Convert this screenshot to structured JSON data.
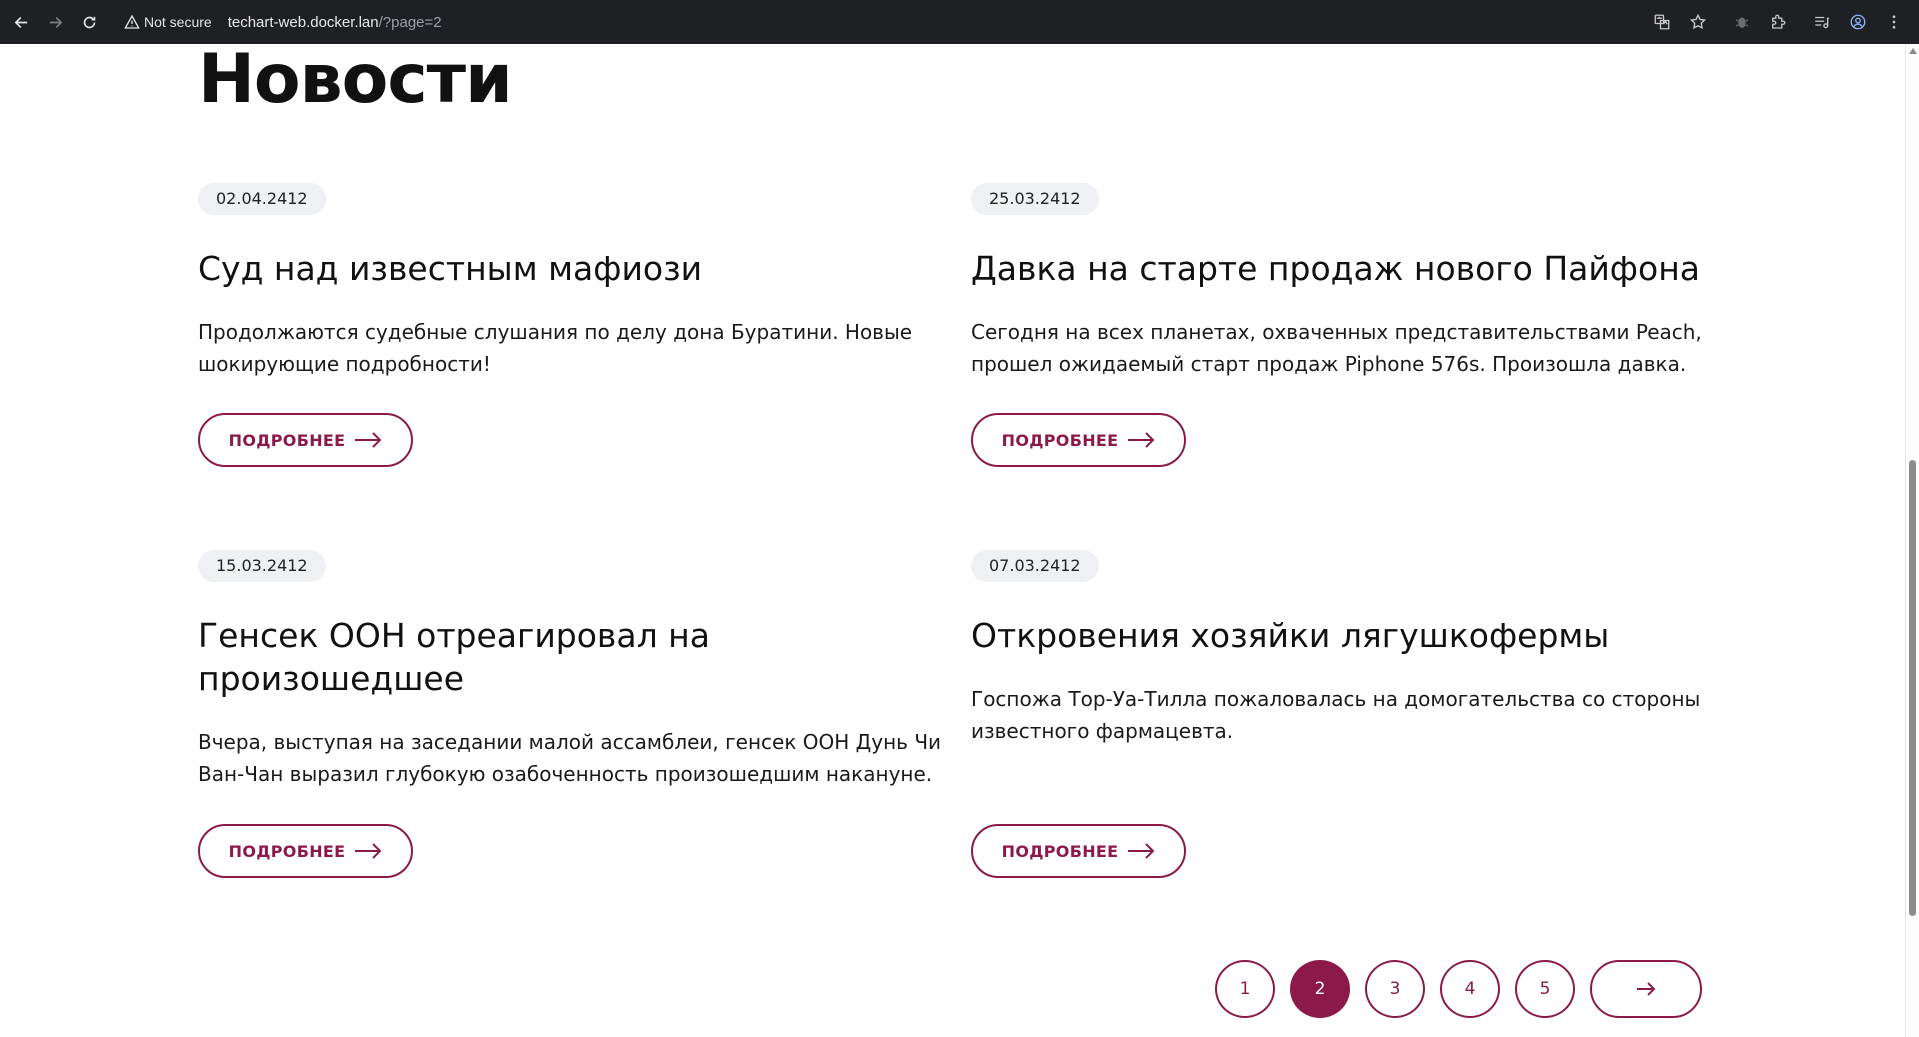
{
  "browser": {
    "security_label": "Not secure",
    "url_host": "techart-web.docker.lan",
    "url_path": "/?page=2"
  },
  "page": {
    "title": "Новости"
  },
  "news": [
    {
      "date": "02.04.2412",
      "title": "Суд над известным мафиози",
      "text": "Продолжаются судебные слушания по делу дона Буратини. Новые шокирующие подробности!",
      "button": "ПОДРОБНЕЕ"
    },
    {
      "date": "25.03.2412",
      "title": "Давка на старте продаж нового Пайфона",
      "text": "Сегодня на всех планетах, охваченных представительствами Peach, прошел ожидаемый старт продаж Piphone 576s. Произошла давка.",
      "button": "ПОДРОБНЕЕ"
    },
    {
      "date": "15.03.2412",
      "title": "Генсек ООН отреагировал на произошедшее",
      "text": "Вчера, выступая на заседании малой ассамблеи, генсек ООН Дунь Чи Ван-Чан выразил глубокую озабоченность произошедшим накануне.",
      "button": "ПОДРОБНЕЕ"
    },
    {
      "date": "07.03.2412",
      "title": "Откровения хозяйки лягушкофермы",
      "text": "Госпожа Тор-Уа-Тилла пожаловалась на домогательства со стороны известного фармацевта.",
      "button": "ПОДРОБНЕЕ"
    }
  ],
  "pagination": {
    "pages": [
      "1",
      "2",
      "3",
      "4",
      "5"
    ],
    "current": "2"
  },
  "colors": {
    "accent": "#8b1a4a",
    "badge_bg": "#eef0f4",
    "chrome_bg": "#1f2023"
  }
}
